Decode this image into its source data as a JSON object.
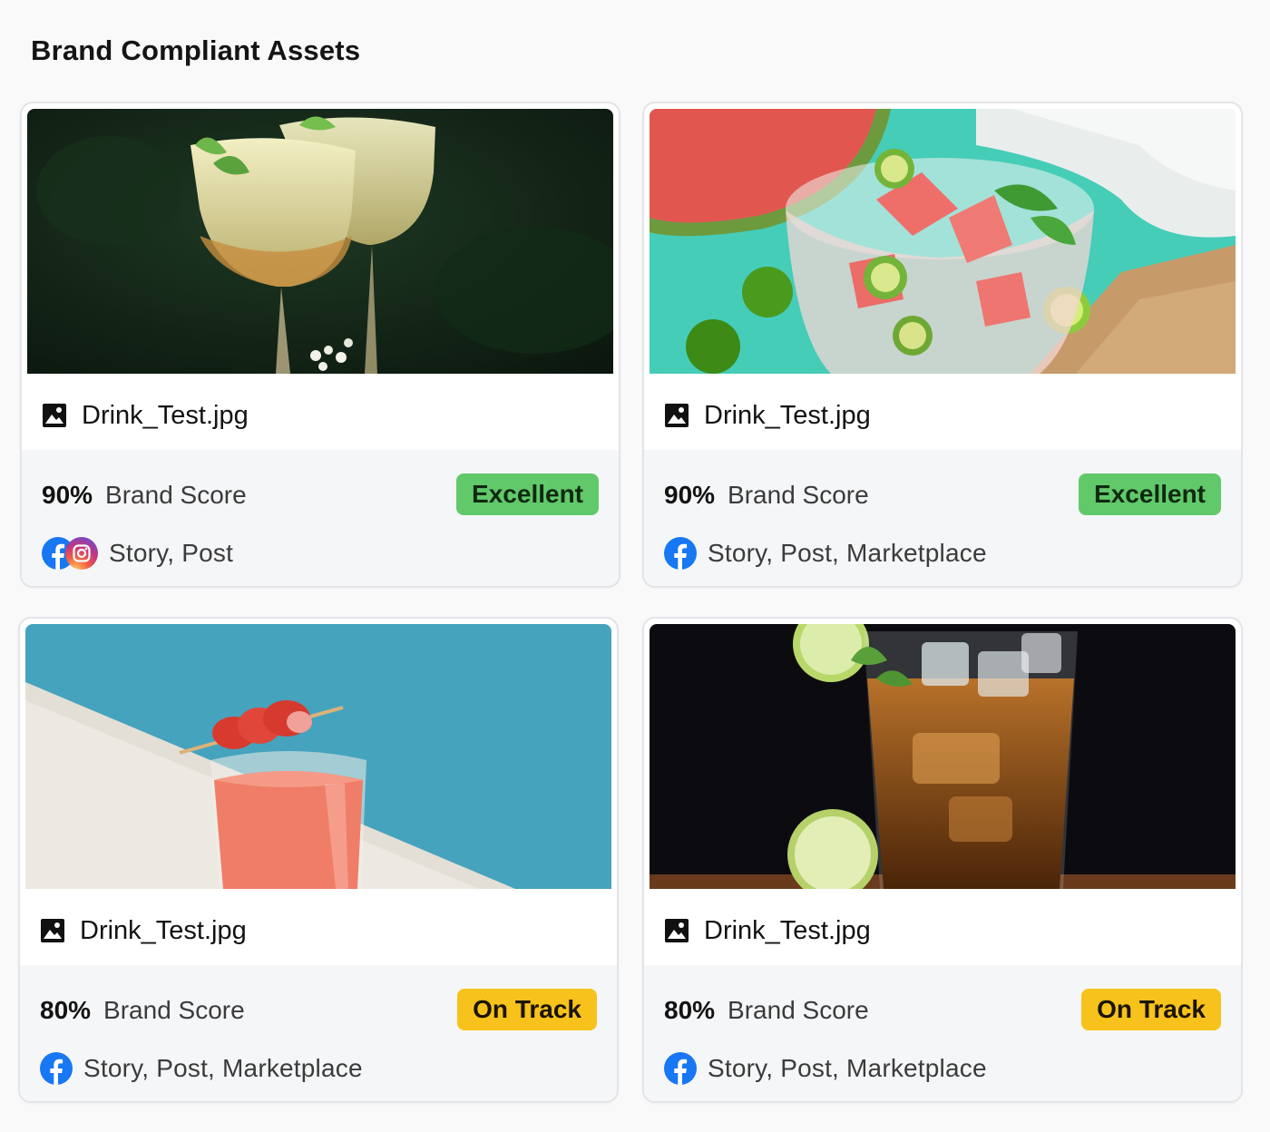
{
  "page": {
    "title": "Brand Compliant Assets"
  },
  "cards": [
    {
      "image_subject": "two elderflower cocktails with mint in stemmed glasses",
      "file_name": "Drink_Test.jpg",
      "score_value": "90%",
      "score_label": "Brand Score",
      "badge": "Excellent",
      "badge_status": "excellent",
      "channels_text": "Story, Post",
      "platforms": [
        "facebook",
        "instagram"
      ]
    },
    {
      "image_subject": "watermelon and calamansi iced drink in glass",
      "file_name": "Drink_Test.jpg",
      "score_value": "90%",
      "score_label": "Brand Score",
      "badge": "Excellent",
      "badge_status": "excellent",
      "channels_text": "Story, Post, Marketplace",
      "platforms": [
        "facebook"
      ]
    },
    {
      "image_subject": "pink juice with strawberry skewer on blue background",
      "file_name": "Drink_Test.jpg",
      "score_value": "80%",
      "score_label": "Brand Score",
      "badge": "On Track",
      "badge_status": "ontrack",
      "channels_text": "Story, Post, Marketplace",
      "platforms": [
        "facebook"
      ]
    },
    {
      "image_subject": "iced tea with lime on dark background",
      "file_name": "Drink_Test.jpg",
      "score_value": "80%",
      "score_label": "Brand Score",
      "badge": "On Track",
      "badge_status": "ontrack",
      "channels_text": "Story, Post, Marketplace",
      "platforms": [
        "facebook"
      ]
    }
  ],
  "colors": {
    "excellent": "#62c96b",
    "ontrack": "#f7c21c",
    "facebook": "#1877f2",
    "card_border": "#e3e4e8",
    "footer_bg": "#f5f6f8"
  },
  "icons": {
    "file": "image-file-icon",
    "facebook": "facebook-icon",
    "instagram": "instagram-icon"
  }
}
